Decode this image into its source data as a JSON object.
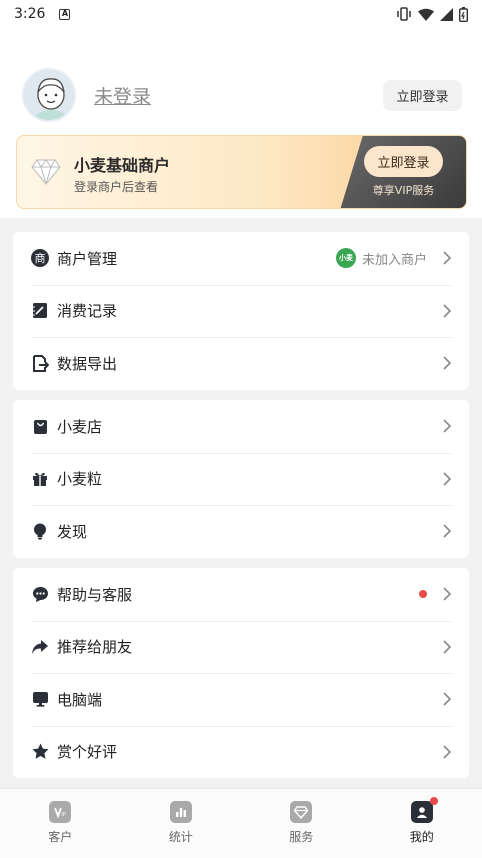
{
  "status_bar": {
    "time": "3:26",
    "a_badge": "A"
  },
  "profile": {
    "login_text": "未登录",
    "login_button": "立即登录"
  },
  "vip": {
    "title": "小麦基础商户",
    "subtitle": "登录商户后查看",
    "button": "立即登录",
    "note": "尊享VIP服务"
  },
  "groups": [
    {
      "items": [
        {
          "label": "商户管理",
          "icon": "merchant-icon",
          "extra": "未加入商户",
          "extra_badge": "小麦"
        },
        {
          "label": "消费记录",
          "icon": "receipt-icon"
        },
        {
          "label": "数据导出",
          "icon": "export-icon"
        }
      ]
    },
    {
      "items": [
        {
          "label": "小麦店",
          "icon": "shop-bag-icon"
        },
        {
          "label": "小麦粒",
          "icon": "gift-icon"
        },
        {
          "label": "发现",
          "icon": "bulb-icon"
        }
      ]
    },
    {
      "items": [
        {
          "label": "帮助与客服",
          "icon": "chat-icon",
          "dot": true
        },
        {
          "label": "推荐给朋友",
          "icon": "share-icon"
        },
        {
          "label": "电脑端",
          "icon": "monitor-icon"
        },
        {
          "label": "赏个好评",
          "icon": "star-icon"
        }
      ]
    }
  ],
  "tabs": [
    {
      "label": "客户",
      "icon": "vip-icon"
    },
    {
      "label": "统计",
      "icon": "chart-icon"
    },
    {
      "label": "服务",
      "icon": "diamond-icon"
    },
    {
      "label": "我的",
      "icon": "user-icon",
      "active": true,
      "dot": true
    }
  ],
  "colors": {
    "accent_red": "#e84a4a",
    "vip_gold": "#fcc98a",
    "badge_green": "#3aa653"
  }
}
